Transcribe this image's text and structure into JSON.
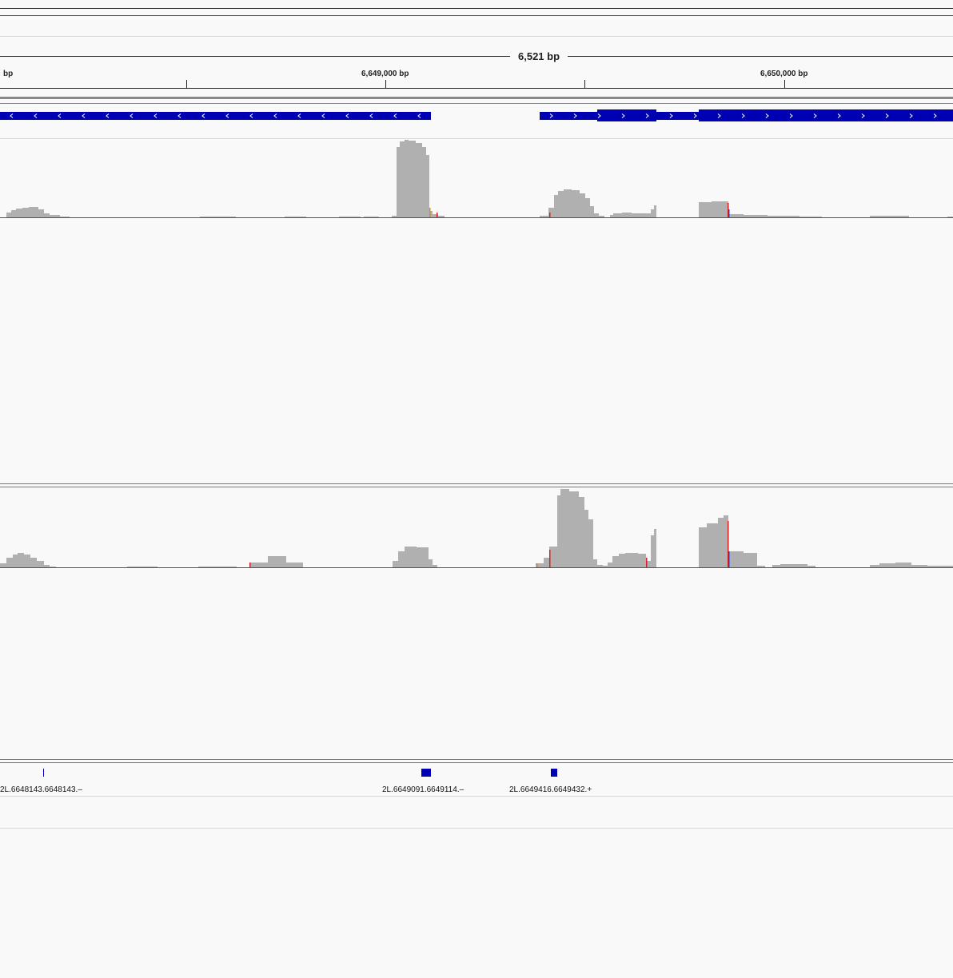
{
  "ruler": {
    "span_label": "6,521 bp",
    "left_fragment": "bp",
    "ticks": [
      {
        "label": "6,649,000 bp"
      },
      {
        "label": "6,650,000 bp"
      }
    ]
  },
  "gene_track": {
    "color": "#0000b3",
    "exons": [
      {
        "start": 0,
        "end": 539,
        "strand": "-"
      },
      {
        "start": 675,
        "end": 1192,
        "strand": "+"
      }
    ]
  },
  "coverage_tracks": [
    {
      "name": "",
      "color": "#b0b0b0"
    },
    {
      "name": "",
      "color": "#b0b0b0"
    }
  ],
  "feature_track": {
    "color": "#0000b3",
    "features": [
      {
        "label": "2L.6648143.6648143.–"
      },
      {
        "label": "2L.6649091.6649114.–"
      },
      {
        "label": "2L.6649416.6649432.+"
      }
    ]
  },
  "colors": {
    "background": "#f9f9f9",
    "divider": "#888888",
    "mismatch_red": "#d62020",
    "mismatch_blue": "#1f3fd6",
    "mismatch_orange": "#d98a1c"
  }
}
